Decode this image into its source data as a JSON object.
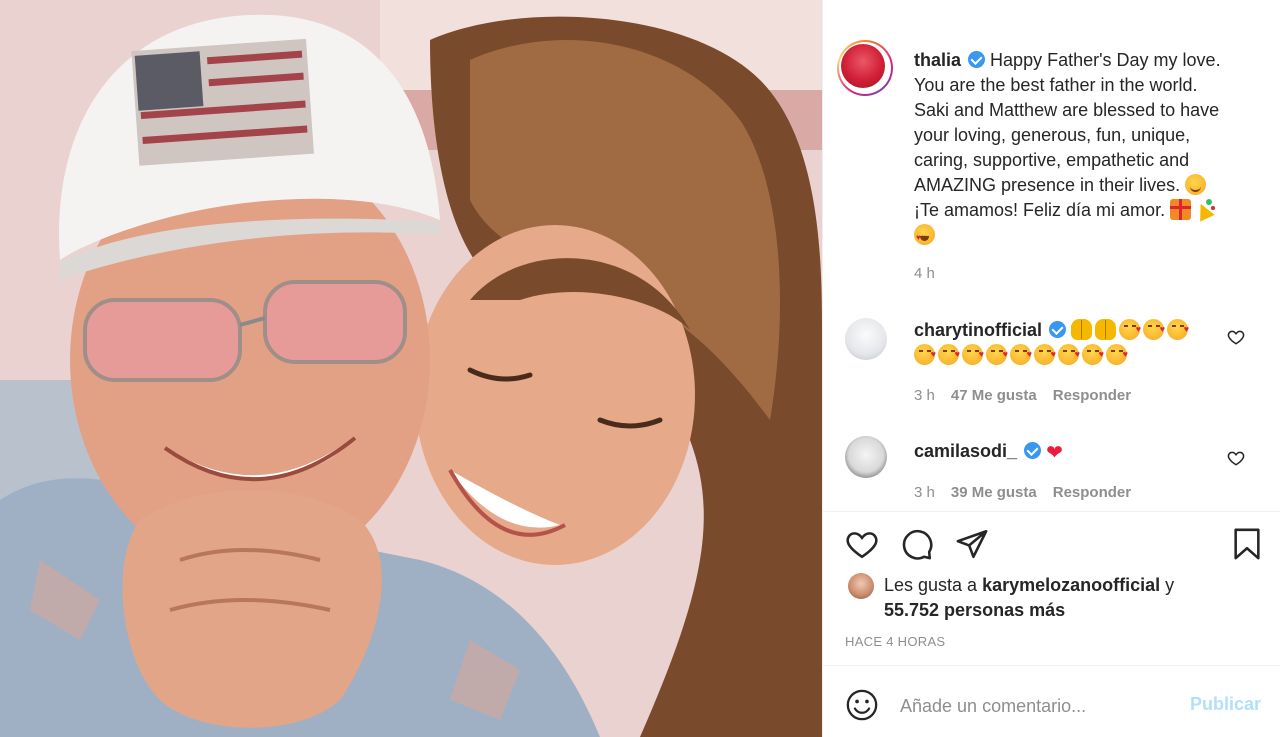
{
  "post": {
    "author": "thalia",
    "caption_lines": [
      "Happy Father's Day my love.",
      "You are the best father in the world.",
      "Saki and Matthew are blessed to have",
      "your loving, generous, fun, unique,",
      "caring, supportive, empathetic and",
      "AMAZING presence in their lives.",
      "¡Te amamos! Feliz día mi amor."
    ],
    "caption_time": "4 h"
  },
  "comments": [
    {
      "author": "charytinofficial",
      "time": "3 h",
      "likes": "47 Me gusta",
      "reply": "Responder"
    },
    {
      "author": "camilasodi_",
      "time": "3 h",
      "likes": "39 Me gusta",
      "reply": "Responder"
    }
  ],
  "likes": {
    "prefix": "Les gusta a",
    "user": "karymelozanoofficial",
    "conjunction": "y",
    "others": "55.752 personas más"
  },
  "timestamp": "HACE 4 HORAS",
  "comment_box": {
    "placeholder": "Añade un comentario...",
    "publish": "Publicar"
  },
  "colors": {
    "verified": "#3897f0",
    "publish_disabled": "#b2dffc",
    "muted": "#8e8e8e",
    "text": "#262626"
  },
  "icons": [
    "verified-icon",
    "heart-icon",
    "comment-icon",
    "share-icon",
    "bookmark-icon",
    "smiley-icon"
  ]
}
